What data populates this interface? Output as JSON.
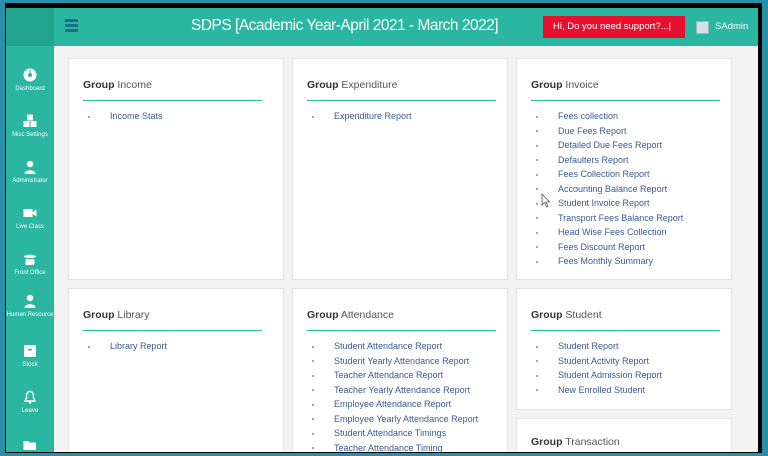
{
  "header": {
    "title": "SDPS [Academic Year-April 2021 - March 2022]",
    "support_label": "Hi, Do you need support?...|",
    "user_name": "SAdmin"
  },
  "sidebar": {
    "items": [
      {
        "label": "Dashboard",
        "icon": "dashboard-icon"
      },
      {
        "label": "Misc Settings",
        "icon": "cubes-icon"
      },
      {
        "label": "Administrator",
        "icon": "user-icon"
      },
      {
        "label": "Live Class",
        "icon": "video-icon"
      },
      {
        "label": "Front Office",
        "icon": "phone-icon"
      },
      {
        "label": "Human Resource",
        "icon": "user-tie-icon"
      },
      {
        "label": "Stock",
        "icon": "archive-icon"
      },
      {
        "label": "Leave",
        "icon": "bell-icon"
      },
      {
        "label": "",
        "icon": "folder-icon"
      }
    ]
  },
  "groups": {
    "income": {
      "bold": "Group",
      "name": "Income",
      "items": [
        "Income Stats"
      ]
    },
    "expenditure": {
      "bold": "Group",
      "name": "Expenditure",
      "items": [
        "Expenditure Report"
      ]
    },
    "invoice": {
      "bold": "Group",
      "name": "Invoice",
      "items": [
        "Fees collection",
        "Due Fees Report",
        "Detailed Due Fees Report",
        "Defaulters Report",
        "Fees Collection Report",
        "Accounting Balance Report",
        "Student Invoice Report",
        "Transport Fees Balance Report",
        "Head Wise Fees Collection",
        "Fees Discount Report",
        "Fees Monthly Summary"
      ]
    },
    "library": {
      "bold": "Group",
      "name": "Library",
      "items": [
        "Library Report"
      ]
    },
    "attendance": {
      "bold": "Group",
      "name": "Attendance",
      "items": [
        "Student Attendance Report",
        "Student Yearly Attendance Report",
        "Teacher Attendance Report",
        "Teacher Yearly Attendance Report",
        "Employee Attendance Report",
        "Employee Yearly Attendance Report",
        "Student Attendance Timings",
        "Teacher Attendance Timing"
      ]
    },
    "student": {
      "bold": "Group",
      "name": "Student",
      "items": [
        "Student Report",
        "Student Activity Report",
        "Student Admission Report",
        "New Enrolled Student"
      ]
    },
    "transaction": {
      "bold": "Group",
      "name": "Transaction",
      "items": []
    }
  },
  "colors": {
    "accent": "#2ab6a0",
    "support": "#e8102e",
    "link": "#3a5a92"
  }
}
